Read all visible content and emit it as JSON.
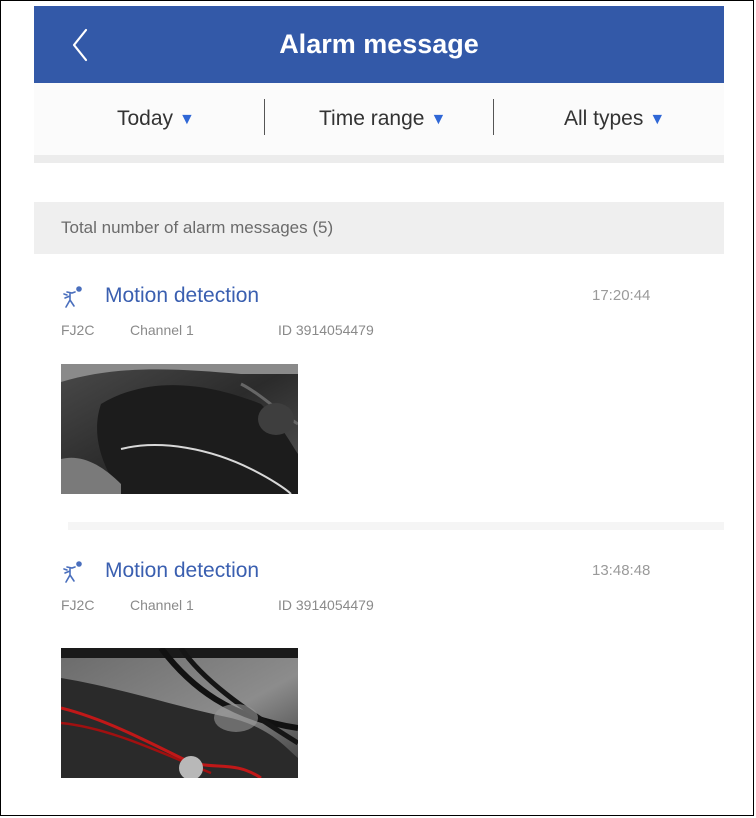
{
  "header": {
    "title": "Alarm message",
    "back_icon": "chevron-left-icon",
    "bg_color": "#3359a8"
  },
  "filters": {
    "date": "Today",
    "time_range": "Time range",
    "types": "All types",
    "dropdown_icon": "triangle-down-icon",
    "accent_color": "#2f67d6"
  },
  "summary": {
    "total_label": "Total number of alarm messages (5)"
  },
  "alarms": [
    {
      "type": "Motion detection",
      "time": "17:20:44",
      "device": "FJ2C",
      "channel": "Channel 1",
      "id": "ID 3914054479",
      "icon": "motion-icon"
    },
    {
      "type": "Motion detection",
      "time": "13:48:48",
      "device": "FJ2C",
      "channel": "Channel 1",
      "id": "ID 3914054479",
      "icon": "motion-icon"
    }
  ]
}
